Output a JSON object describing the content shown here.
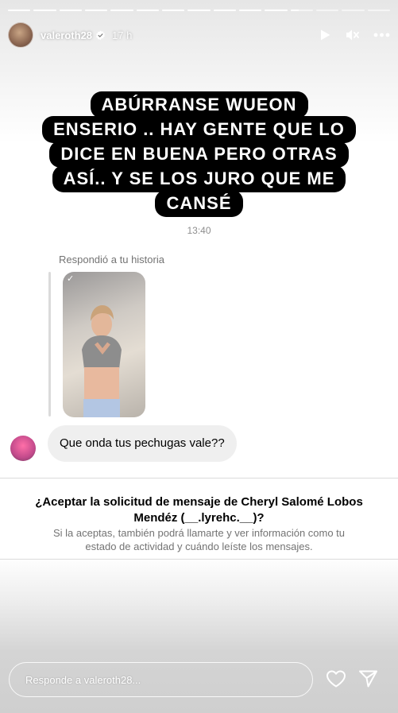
{
  "story": {
    "progress_segments": 15,
    "progress_completed": 11,
    "progress_current_fill": 0.35
  },
  "header": {
    "username": "valeroth28",
    "time_ago": "17 h",
    "icons": [
      "play-icon",
      "muted-icon",
      "more-icon"
    ]
  },
  "caption": {
    "lines": [
      "ABÚRRANSE WUEON",
      "ENSERIO  .. HAY GENTE QUE LO",
      "DICE EN BUENA PERO OTRAS",
      "ASÍ.. Y SE LOS JURO QUE ME",
      "CANSÉ"
    ]
  },
  "screenshot": {
    "message_time": "13:40",
    "replied_label": "Respondió a tu historia",
    "message_text": "Que onda tus pechugas vale??",
    "request_title_line1": "¿Aceptar la solicitud de mensaje de Cheryl Salomé Lobos",
    "request_title_line2": "Mendéz (__.lyrehc.__)?",
    "request_sub_line1": "Si la aceptas, también podrá llamarte y ver información como tu",
    "request_sub_line2": "estado de actividad y cuándo leíste los mensajes."
  },
  "reply": {
    "placeholder": "Responde a valeroth28...",
    "icons": [
      "heart-icon",
      "send-icon"
    ]
  },
  "colors": {
    "caption_bg": "#000000",
    "caption_text": "#ffffff",
    "bubble_bg": "#efefef",
    "muted_text": "#737373"
  }
}
